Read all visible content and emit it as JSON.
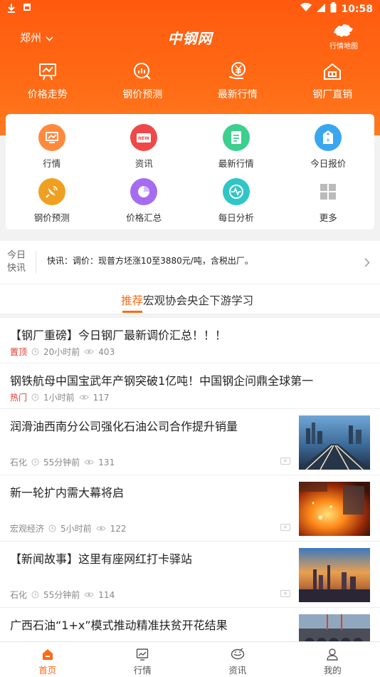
{
  "status_bar": {
    "time": "10:58",
    "icons": [
      "download-icon",
      "notification-icon",
      "wifi-icon",
      "signal-icon",
      "battery-icon"
    ]
  },
  "header": {
    "city": "郑州",
    "logo": "中钢网",
    "map_label": "行情地图"
  },
  "quick_links": [
    {
      "label": "价格走势",
      "icon": "trend-board-icon"
    },
    {
      "label": "钢价预测",
      "icon": "search-chart-icon"
    },
    {
      "label": "最新行情",
      "icon": "yuan-hand-icon"
    },
    {
      "label": "钢厂直销",
      "icon": "factory-icon"
    }
  ],
  "grid_items": [
    {
      "label": "行情",
      "icon": "market-icon",
      "color": "#ff8a3d"
    },
    {
      "label": "资讯",
      "icon": "news-icon",
      "color": "#f04848"
    },
    {
      "label": "最新行情",
      "icon": "document-icon",
      "color": "#3ccf8e"
    },
    {
      "label": "今日报价",
      "icon": "price-tag-icon",
      "color": "#3aa6f0"
    },
    {
      "label": "钢价预测",
      "icon": "satellite-icon",
      "color": "#f0a020"
    },
    {
      "label": "价格汇总",
      "icon": "pie-chart-icon",
      "color": "#a56cf0"
    },
    {
      "label": "每日分析",
      "icon": "pulse-icon",
      "color": "#2ec6c6"
    },
    {
      "label": "更多",
      "icon": "more-grid-icon",
      "color": "#bbbbbb"
    }
  ],
  "flash": {
    "tag": "今日快讯",
    "message": "快讯：调价：现普方坯涨10至3880元/吨，含税出厂。"
  },
  "tabs": [
    {
      "label": "推荐",
      "active": true
    },
    {
      "label": "宏观",
      "active": false
    },
    {
      "label": "协会",
      "active": false
    },
    {
      "label": "央企",
      "active": false
    },
    {
      "label": "下游",
      "active": false
    },
    {
      "label": "学习",
      "active": false
    }
  ],
  "feed": [
    {
      "title": "【钢厂重磅】今日钢厂最新调价汇总！！！",
      "tag": "置顶",
      "time": "20小时前",
      "views": "403"
    },
    {
      "title": "钢铁航母中国宝武年产钢突破1亿吨！中国钢企问鼎全球第一",
      "tag": "热门",
      "time": "1小时前",
      "views": "117"
    },
    {
      "title": "润滑油西南分公司强化石油公司合作提升销量",
      "tag": "石化",
      "time": "55分钟前",
      "views": "131",
      "image": "city-highway-image"
    },
    {
      "title": "新一轮扩内需大幕将启",
      "tag": "宏观经济",
      "time": "5小时前",
      "views": "122",
      "image": "molten-steel-image"
    },
    {
      "title": "【新闻故事】这里有座网红打卡驿站",
      "tag": "石化",
      "time": "55分钟前",
      "views": "114",
      "image": "sunset-city-image"
    },
    {
      "title": "广西石油“1+x”模式推动精准扶贫开花结果",
      "image": "pipes-image"
    }
  ],
  "bottom_nav": [
    {
      "label": "首页",
      "active": true
    },
    {
      "label": "行情",
      "active": false
    },
    {
      "label": "资讯",
      "active": false
    },
    {
      "label": "我的",
      "active": false
    }
  ],
  "colors": {
    "accent": "#ff6a14",
    "hot": "#e6382b"
  }
}
